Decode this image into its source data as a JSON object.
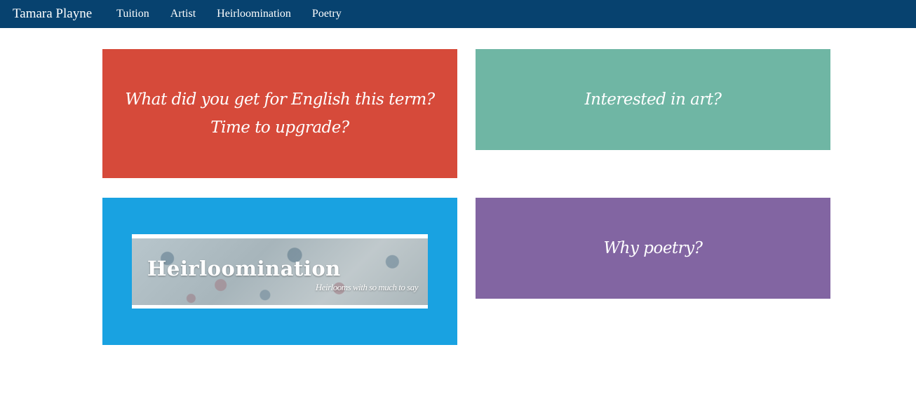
{
  "nav": {
    "brand": "Tamara Playne",
    "links": [
      "Tuition",
      "Artist",
      "Heirloomination",
      "Poetry"
    ]
  },
  "tiles": {
    "english": {
      "line1": "What did you get for English this term?",
      "line2": "Time to upgrade?",
      "color": "#d64a3a"
    },
    "art": {
      "text": "Interested in art?",
      "color": "#6fb6a4"
    },
    "heirloomination": {
      "banner_title": "Heirloomination",
      "banner_tagline": "Heirlooms with so much to say",
      "color": "#19a2e1"
    },
    "poetry": {
      "text": "Why poetry?",
      "color": "#8265a2"
    }
  },
  "colors": {
    "navbar": "#07426f"
  }
}
